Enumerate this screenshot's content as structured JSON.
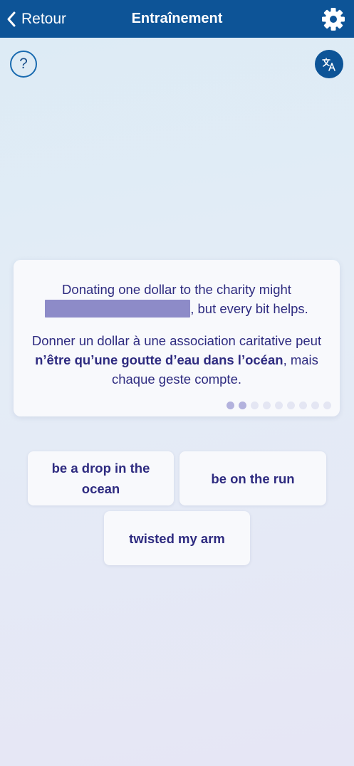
{
  "header": {
    "back_label": "Retour",
    "title": "Entraînement",
    "back_icon": "chevron-left-icon",
    "settings_icon": "gear-icon",
    "background": "#0d5497"
  },
  "help_button": {
    "label": "?"
  },
  "translate_button": {
    "icon": "translate-icon"
  },
  "exercise": {
    "sentence_before": "Donating one dollar to the charity might",
    "sentence_after": ", but every bit helps.",
    "translation_before": "Donner un dollar à une association caritative peut ",
    "translation_highlight": "n’être qu’une goutte d’eau dans l’océan",
    "translation_after": ", mais chaque geste compte.",
    "progress": {
      "current": 2,
      "total": 9
    }
  },
  "options": [
    {
      "label": "be a drop in the ocean"
    },
    {
      "label": "be on the run"
    },
    {
      "label": "twisted my arm"
    }
  ],
  "colors": {
    "text": "#2e2b80",
    "blank": "#8d8bc8",
    "accent": "#0d5497"
  }
}
